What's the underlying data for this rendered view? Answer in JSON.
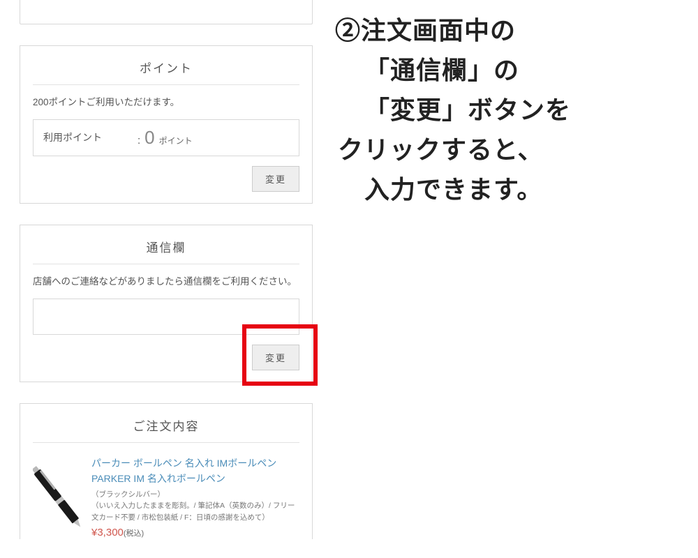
{
  "points_section": {
    "title": "ポイント",
    "available": "200ポイントご利用いただけます。",
    "label": "利用ポイント",
    "colon": ":",
    "value": "0",
    "unit": "ポイント",
    "change_btn": "変更"
  },
  "message_section": {
    "title": "通信欄",
    "description": "店舗へのご連絡などがありましたら通信欄をご利用ください。",
    "change_btn": "変更"
  },
  "order_section": {
    "title": "ご注文内容",
    "product_name": "パーカー ボールペン 名入れ IMボールペン PARKER IM 名入れボールペン",
    "options_line1": "（ブラックシルバー）",
    "options_line2": "（いいえ入力したままを彫刻。/ 筆記体A（英数のみ）/ フリー文カード不要 / 市松包装紙 / F：日頃の感謝を込めて）",
    "price": "¥3,300",
    "tax": "(税込)"
  },
  "instruction": {
    "line1": "②注文画面中の",
    "line2": "「通信欄」の",
    "line3": "「変更」ボタンを",
    "line4": "クリックすると、",
    "line5": "入力できます。"
  }
}
